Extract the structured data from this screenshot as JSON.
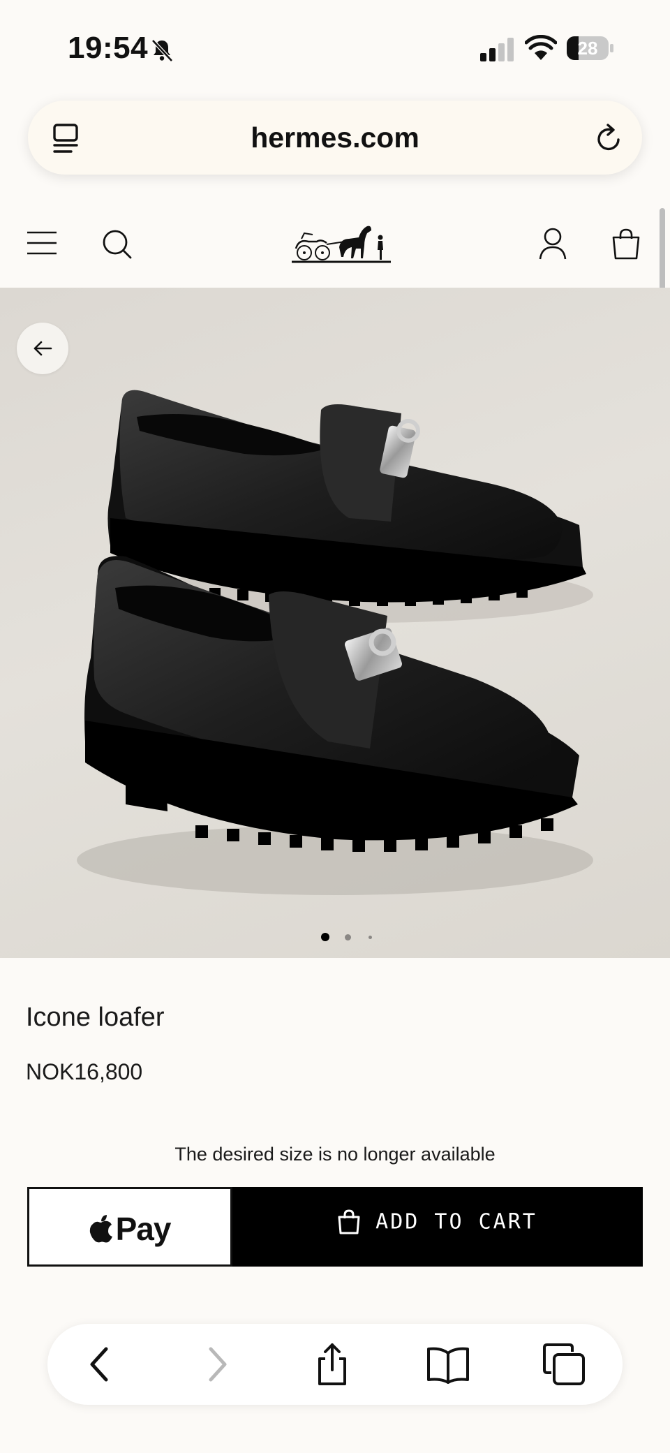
{
  "status_bar": {
    "time": "19:54",
    "battery": "28",
    "battery_level": 0.28
  },
  "browser": {
    "url": "hermes.com"
  },
  "product": {
    "name": "Icone loafer",
    "price": "NOK16,800",
    "availability_note": "The desired size is no longer available",
    "image_count": 3,
    "active_image": 1
  },
  "actions": {
    "apple_pay_label": "Pay",
    "add_to_cart_label": "ADD TO CART"
  },
  "icons": {
    "bell": "bell-slash-icon",
    "signal": "cellular-signal-icon",
    "wifi": "wifi-icon",
    "tabs": "tab-overview-icon",
    "reload": "reload-icon",
    "menu": "hamburger-menu-icon",
    "search": "search-icon",
    "account": "account-icon",
    "bag": "shopping-bag-icon",
    "back": "arrow-left-icon",
    "browser_back": "chevron-left-icon",
    "browser_forward": "chevron-right-icon",
    "share": "share-icon",
    "bookmarks": "book-icon",
    "tabs_toolbar": "tabs-icon"
  },
  "colors": {
    "background": "#fcfaf7",
    "button_dark": "#000000",
    "hero_bg": "#dedad4"
  }
}
